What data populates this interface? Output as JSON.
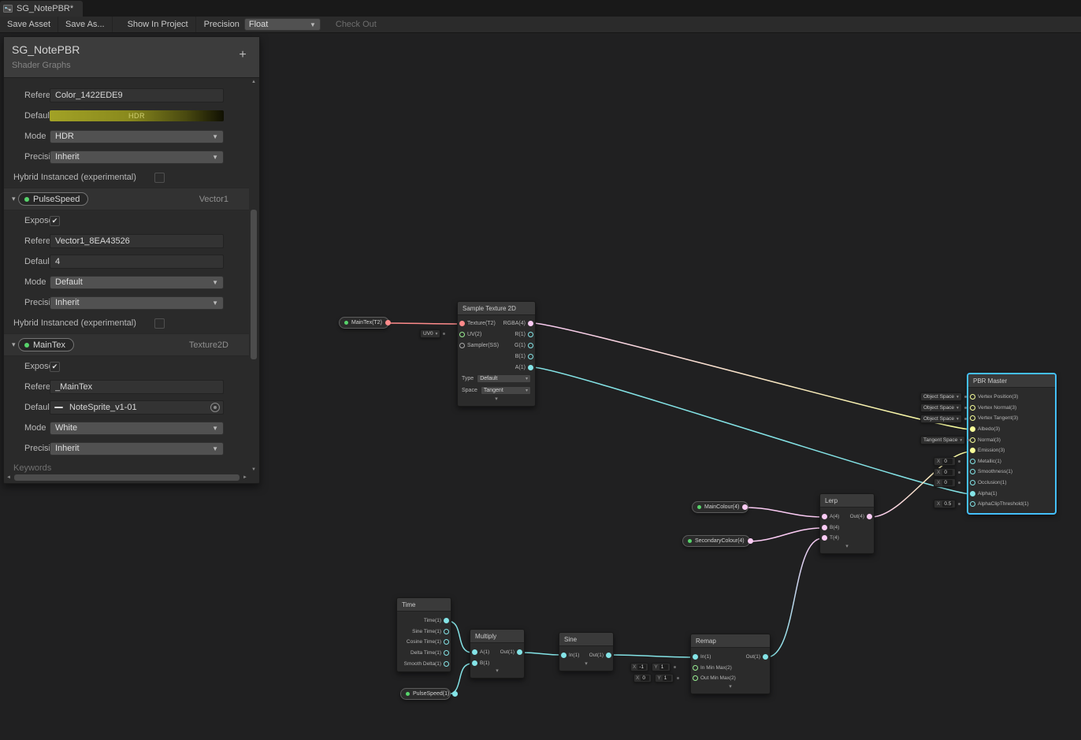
{
  "tab": {
    "title": "SG_NotePBR*"
  },
  "toolbar": {
    "save_asset": "Save Asset",
    "save_as": "Save As...",
    "show_in_project": "Show In Project",
    "precision_label": "Precision",
    "precision_value": "Float",
    "check_out": "Check Out"
  },
  "blackboard": {
    "title": "SG_NotePBR",
    "subtitle": "Shader Graphs",
    "add_button": "+",
    "keywords_label": "Keywords",
    "labels": {
      "reference": "Reference",
      "default": "Default",
      "mode": "Mode",
      "precision": "Precision",
      "exposed": "Exposed",
      "hybrid": "Hybrid Instanced (experimental)"
    },
    "color_property": {
      "reference": "Color_1422EDE9",
      "default_swatch_text": "HDR",
      "mode": "HDR",
      "precision": "Inherit"
    },
    "pulse_property": {
      "name": "PulseSpeed",
      "type": "Vector1",
      "reference": "Vector1_8EA43526",
      "default": "4",
      "mode": "Default",
      "precision": "Inherit"
    },
    "maintex_property": {
      "name": "MainTex",
      "type": "Texture2D",
      "reference": "_MainTex",
      "default": "NoteSprite_v1-01",
      "mode": "White",
      "precision": "Inherit"
    }
  },
  "graph": {
    "sample_texture": {
      "title": "Sample Texture 2D",
      "inputs": [
        "Texture(T2)",
        "UV(2)",
        "Sampler(SS)"
      ],
      "outputs": [
        "RGBA(4)",
        "R(1)",
        "G(1)",
        "B(1)",
        "A(1)"
      ],
      "type_label": "Type",
      "type_value": "Default",
      "space_label": "Space",
      "space_value": "Tangent",
      "uv_channel": "UV0"
    },
    "pbr_master": {
      "title": "PBR Master",
      "inputs": [
        "Vertex Position(3)",
        "Vertex Normal(3)",
        "Vertex Tangent(3)",
        "Albedo(3)",
        "Normal(3)",
        "Emission(3)",
        "Metallic(1)",
        "Smoothness(1)",
        "Occlusion(1)",
        "Alpha(1)",
        "AlphaClipThreshold(1)"
      ],
      "space_widgets": [
        "Object Space",
        "Object Space",
        "Object Space",
        "Tangent Space"
      ],
      "value_widgets": [
        {
          "label": "X",
          "value": "0"
        },
        {
          "label": "X",
          "value": "0"
        },
        {
          "label": "X",
          "value": "0"
        },
        {
          "label": "X",
          "value": "0.5"
        }
      ]
    },
    "lerp": {
      "title": "Lerp",
      "inputs": [
        "A(4)",
        "B(4)",
        "T(4)"
      ],
      "outputs": [
        "Out(4)"
      ]
    },
    "time": {
      "title": "Time",
      "outputs": [
        "Time(1)",
        "Sine Time(1)",
        "Cosine Time(1)",
        "Delta Time(1)",
        "Smooth Delta(1)"
      ]
    },
    "multiply": {
      "title": "Multiply",
      "inputs": [
        "A(1)",
        "B(1)"
      ],
      "outputs": [
        "Out(1)"
      ]
    },
    "sine": {
      "title": "Sine",
      "inputs": [
        "In(1)"
      ],
      "outputs": [
        "Out(1)"
      ]
    },
    "remap": {
      "title": "Remap",
      "inputs": [
        "In(1)",
        "In Min Max(2)",
        "Out Min Max(2)"
      ],
      "outputs": [
        "Out(1)"
      ],
      "in_min_max": {
        "x_label": "X",
        "x_value": "-1",
        "y_label": "Y",
        "y_value": "1"
      },
      "out_min_max": {
        "x_label": "X",
        "x_value": "0",
        "y_label": "Y",
        "y_value": "1"
      }
    },
    "pills": {
      "maintex": "MainTex(T2)",
      "main_colour": "MainColour(4)",
      "secondary_colour": "SecondaryColour(4)",
      "pulse_speed": "PulseSpeed(1)"
    }
  },
  "colors": {
    "vector1": "#84E4E7",
    "vector2": "#9AEF92",
    "vector3": "#F8FF9A",
    "vector4": "#FBCBF4",
    "texture2d": "#FF8B8B",
    "sampler": "#AAAAAA",
    "exposed_dot": "#57D46B",
    "selection": "#44C0FF",
    "hdr_swatch": "#8A8A1D"
  }
}
